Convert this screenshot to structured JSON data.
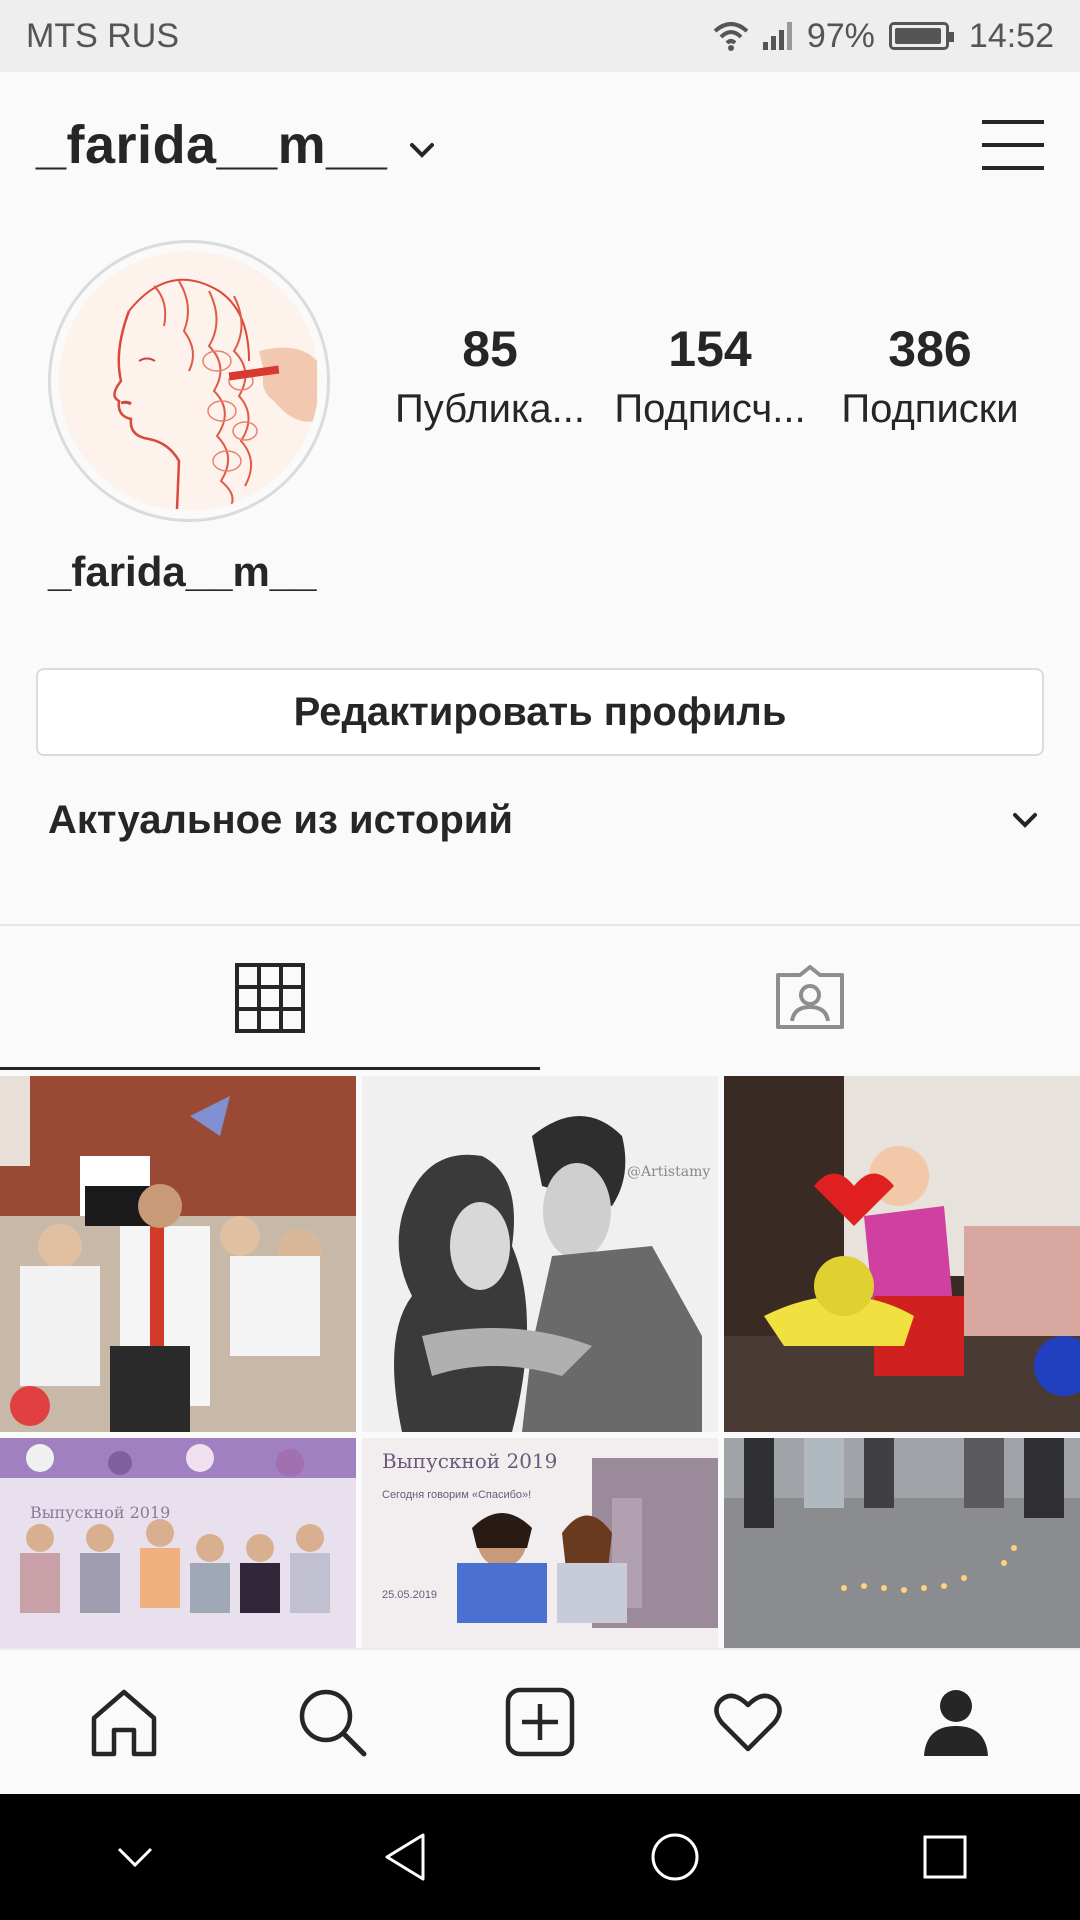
{
  "status_bar": {
    "carrier": "MTS RUS",
    "battery_percent": "97%",
    "battery_level": 0.97,
    "time": "14:52",
    "wifi_icon": "wifi-icon",
    "signal_icon": "signal-icon"
  },
  "header": {
    "username": "_farida__m__",
    "account_switch_icon": "chevron-down-icon",
    "menu_icon": "hamburger-menu-icon"
  },
  "profile": {
    "display_name": "_farida__m__",
    "avatar_icon": "profile-avatar",
    "stats": [
      {
        "value": "85",
        "label": "Публика..."
      },
      {
        "value": "154",
        "label": "Подписч..."
      },
      {
        "value": "386",
        "label": "Подписки"
      }
    ],
    "edit_button": "Редактировать профиль"
  },
  "highlights": {
    "title": "Актуальное из историй",
    "expand_icon": "chevron-down-icon"
  },
  "tabs": [
    {
      "icon": "grid-icon",
      "active": true
    },
    {
      "icon": "tagged-icon",
      "active": false
    }
  ],
  "grid": {
    "posts": [
      {
        "icon": "photo-thumbnail"
      },
      {
        "icon": "photo-thumbnail"
      },
      {
        "icon": "photo-thumbnail"
      },
      {
        "icon": "photo-thumbnail"
      },
      {
        "icon": "photo-thumbnail"
      },
      {
        "icon": "photo-thumbnail"
      }
    ]
  },
  "bottom_nav": [
    {
      "icon": "home-icon"
    },
    {
      "icon": "search-icon"
    },
    {
      "icon": "new-post-icon"
    },
    {
      "icon": "activity-heart-icon"
    },
    {
      "icon": "profile-icon",
      "active": true
    }
  ],
  "android_nav": [
    {
      "icon": "hide-keyboard-icon"
    },
    {
      "icon": "back-icon"
    },
    {
      "icon": "home-circle-icon"
    },
    {
      "icon": "recents-icon"
    }
  ]
}
